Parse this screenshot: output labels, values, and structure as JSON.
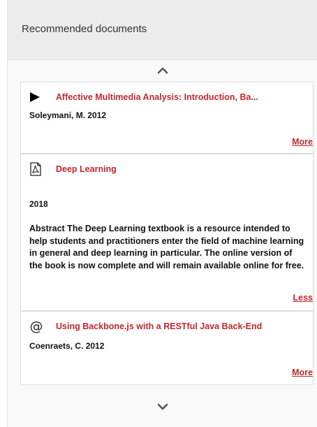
{
  "panel": {
    "title": "Recommended documents"
  },
  "documents": [
    {
      "icon": "play-icon",
      "title": "Affective Multimedia Analysis: Introduction, Ba...",
      "meta": "Soleymani, M. 2012",
      "toggle": "More"
    },
    {
      "icon": "pdf-icon",
      "title": "Deep Learning",
      "meta": "2018",
      "abstract": "Abstract The Deep Learning textbook is a resource intended to help students and practitioners enter the field of machine learning in general and deep learning in particular. The online version of the book is now complete and will remain available online for free.",
      "toggle": "Less"
    },
    {
      "icon": "at-icon",
      "title": "Using Backbone.js with a RESTful Java Back-End",
      "meta": "Coenraets, C. 2012",
      "toggle": "More"
    }
  ],
  "colors": {
    "accent": "#c0282d",
    "header_bg": "#ececec"
  }
}
